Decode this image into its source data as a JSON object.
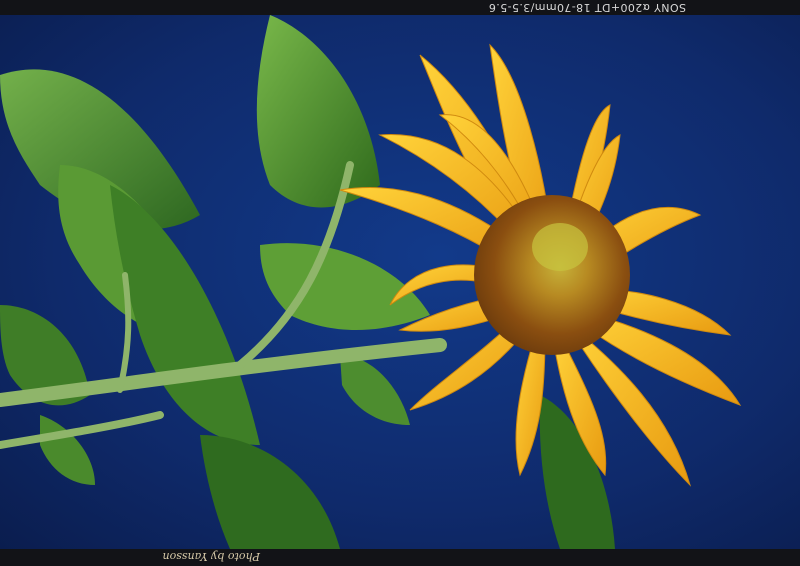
{
  "camera_caption": "SONY α200+DT 18-70mm/3.5-5.6",
  "photo_credit": "Photo by Yansson",
  "scene": {
    "sky_color": "#0f2a6b",
    "petal_color": "#f2b51c",
    "center_color": "#9a5a12",
    "leaf_color": "#4e8f2c"
  }
}
